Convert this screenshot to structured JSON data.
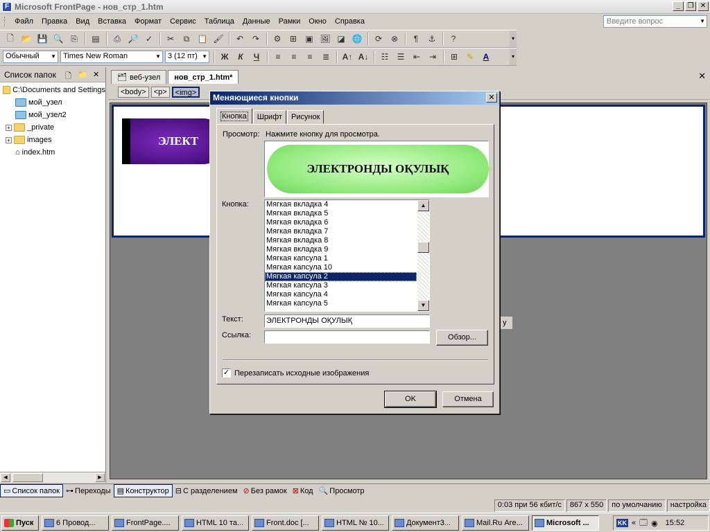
{
  "window": {
    "title": "Microsoft FrontPage - нов_стр_1.htm"
  },
  "menu": [
    "Файл",
    "Правка",
    "Вид",
    "Вставка",
    "Формат",
    "Сервис",
    "Таблица",
    "Данные",
    "Рамки",
    "Окно",
    "Справка"
  ],
  "ask_placeholder": "Введите вопрос",
  "format": {
    "style": "Обычный",
    "font": "Times New Roman",
    "size": "3  (12 пт)"
  },
  "folder_panel": {
    "title": "Список папок",
    "items": [
      {
        "label": "C:\\Documents and Settings",
        "type": "web-root",
        "expand": ""
      },
      {
        "label": "мой_узел",
        "type": "web",
        "expand": ""
      },
      {
        "label": "мой_узел2",
        "type": "web",
        "expand": ""
      },
      {
        "label": "_private",
        "type": "folder",
        "expand": "+"
      },
      {
        "label": "images",
        "type": "folder",
        "expand": "+"
      },
      {
        "label": "index.htm",
        "type": "page",
        "expand": ""
      }
    ]
  },
  "doc_tabs": [
    "веб-узел",
    "нов_стр_1.htm*"
  ],
  "tags": [
    "<body>",
    "<p>",
    "<img>"
  ],
  "page_button_text": "ЭЛЕКТРОНДЫ ОҚУЛЫҚ",
  "page_button_visible": "ЭЛЕКТ",
  "ghost_button_text": "у",
  "view_tabs": [
    "Список папок",
    "Переходы",
    "Конструктор",
    "С разделением",
    "Без рамок",
    "Код",
    "Просмотр"
  ],
  "status": [
    "0:03 при 56 кбит/с",
    "867 x 550",
    "по умолчанию",
    "настройка"
  ],
  "taskbar": {
    "start": "Пуск",
    "items": [
      "6 Провод...",
      "FrontPage....",
      "HTML 10 та...",
      "Front.doc [...",
      "HTML № 10...",
      "Документ3...",
      "Mail.Ru Аге...",
      "Microsoft ..."
    ],
    "lang": "KK",
    "clock": "15:52"
  },
  "dialog": {
    "title": "Меняющиеся кнопки",
    "tabs": [
      "Кнопка",
      "Шрифт",
      "Рисунок"
    ],
    "preview_label": "Просмотр:",
    "preview_hint": "Нажмите кнопку для просмотра.",
    "button_label": "Кнопка:",
    "button_list": [
      "Мягкая вкладка 4",
      "Мягкая вкладка 5",
      "Мягкая вкладка 6",
      "Мягкая вкладка 7",
      "Мягкая вкладка 8",
      "Мягкая вкладка 9",
      "Мягкая капсула 1",
      "Мягкая капсула 10",
      "Мягкая капсула 2",
      "Мягкая капсула 3",
      "Мягкая капсула 4",
      "Мягкая капсула 5"
    ],
    "selected_button": "Мягкая капсула 2",
    "text_label": "Текст:",
    "text_value": "ЭЛЕКТРОНДЫ ОҚУЛЫҚ",
    "link_label": "Ссылка:",
    "link_value": "",
    "browse": "Обзор...",
    "overwrite": "Перезаписать исходные изображения",
    "overwrite_checked": true,
    "ok": "OK",
    "cancel": "Отмена",
    "preview_color": "#8ee878"
  },
  "colors": {
    "titlebar_active": "#0a246a",
    "page_button": "#5a1898"
  }
}
